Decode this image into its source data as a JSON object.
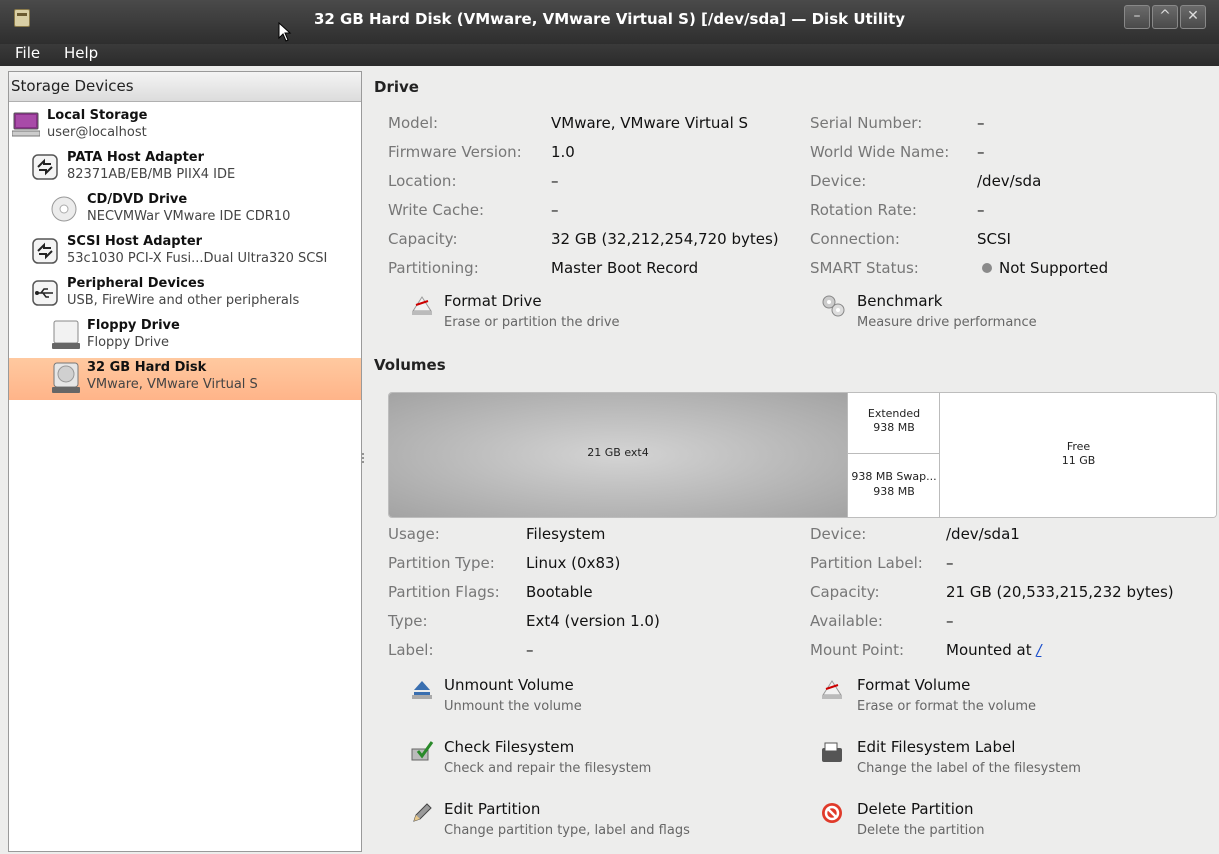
{
  "window": {
    "title": "32 GB Hard Disk (VMware, VMware Virtual S) [/dev/sda] — Disk Utility"
  },
  "menu": {
    "file": "File",
    "help": "Help"
  },
  "sidebar": {
    "header": "Storage Devices",
    "items": [
      {
        "title": "Local Storage",
        "subtitle": "user@localhost"
      },
      {
        "title": "PATA Host Adapter",
        "subtitle": "82371AB/EB/MB PIIX4 IDE"
      },
      {
        "title": "CD/DVD Drive",
        "subtitle": "NECVMWar VMware IDE CDR10"
      },
      {
        "title": "SCSI Host Adapter",
        "subtitle": "53c1030 PCI-X Fusi...Dual Ultra320 SCSI"
      },
      {
        "title": "Peripheral Devices",
        "subtitle": "USB, FireWire and other peripherals"
      },
      {
        "title": "Floppy Drive",
        "subtitle": "Floppy Drive"
      },
      {
        "title": "32 GB Hard Disk",
        "subtitle": "VMware, VMware Virtual S"
      }
    ]
  },
  "drive": {
    "title": "Drive",
    "left": [
      {
        "label": "Model:",
        "value": "VMware, VMware Virtual S"
      },
      {
        "label": "Firmware Version:",
        "value": "1.0"
      },
      {
        "label": "Location:",
        "value": "–"
      },
      {
        "label": "Write Cache:",
        "value": "–"
      },
      {
        "label": "Capacity:",
        "value": "32 GB (32,212,254,720 bytes)"
      },
      {
        "label": "Partitioning:",
        "value": "Master Boot Record"
      }
    ],
    "right": [
      {
        "label": "Serial Number:",
        "value": "–"
      },
      {
        "label": "World Wide Name:",
        "value": "–"
      },
      {
        "label": "Device:",
        "value": "/dev/sda"
      },
      {
        "label": "Rotation Rate:",
        "value": "–"
      },
      {
        "label": "Connection:",
        "value": "SCSI"
      },
      {
        "label": "SMART Status:",
        "value": "Not Supported"
      }
    ],
    "actions": {
      "format": {
        "name": "Format Drive",
        "desc": "Erase or partition the drive"
      },
      "benchmark": {
        "name": "Benchmark",
        "desc": "Measure drive performance"
      }
    }
  },
  "volumes": {
    "title": "Volumes",
    "segments": {
      "ext4": "21 GB ext4",
      "extended_name": "Extended",
      "extended_size": "938 MB",
      "swap_name": "938 MB Swap...",
      "swap_size": "938 MB",
      "free_name": "Free",
      "free_size": "11 GB"
    },
    "left": [
      {
        "label": "Usage:",
        "value": "Filesystem"
      },
      {
        "label": "Partition Type:",
        "value": "Linux (0x83)"
      },
      {
        "label": "Partition Flags:",
        "value": "Bootable"
      },
      {
        "label": "Type:",
        "value": "Ext4 (version 1.0)"
      },
      {
        "label": "Label:",
        "value": "–"
      }
    ],
    "right": [
      {
        "label": "Device:",
        "value": "/dev/sda1"
      },
      {
        "label": "Partition Label:",
        "value": "–"
      },
      {
        "label": "Capacity:",
        "value": "21 GB (20,533,215,232 bytes)"
      },
      {
        "label": "Available:",
        "value": "–"
      },
      {
        "label": "Mount Point:",
        "value": "Mounted at ",
        "link": "/"
      }
    ],
    "actions": {
      "unmount": {
        "name": "Unmount Volume",
        "desc": "Unmount the volume"
      },
      "format_volume": {
        "name": "Format Volume",
        "desc": "Erase or format the volume"
      },
      "check": {
        "name": "Check Filesystem",
        "desc": "Check and repair the filesystem"
      },
      "edit_label": {
        "name": "Edit Filesystem Label",
        "desc": "Change the label of the filesystem"
      },
      "edit_partition": {
        "name": "Edit Partition",
        "desc": "Change partition type, label and flags"
      },
      "delete": {
        "name": "Delete Partition",
        "desc": "Delete the partition"
      }
    }
  }
}
